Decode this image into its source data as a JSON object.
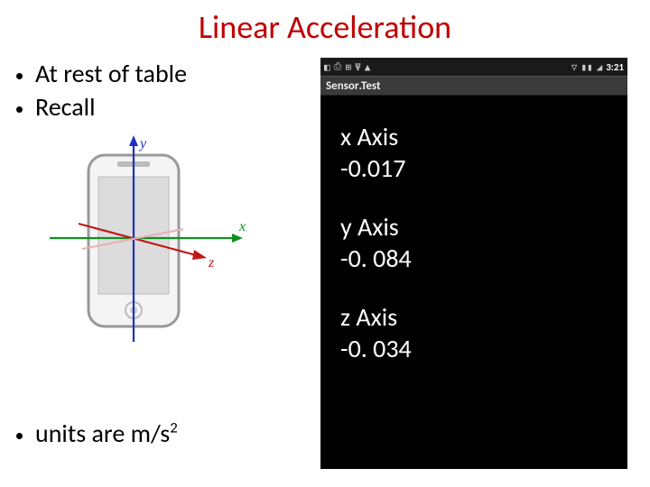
{
  "title": "Linear Acceleration",
  "bullets": {
    "b1": "At rest of table",
    "b2": "Recall",
    "b3_prefix": "units are m/s",
    "b3_exp": "2"
  },
  "axes": {
    "x": "x",
    "y": "y",
    "z": "z"
  },
  "statusbar": {
    "icons": [
      "◧",
      "⎙",
      "⊞",
      "Ψ",
      "▲"
    ],
    "right_icons": [
      "▽",
      "▮▮",
      "◢"
    ],
    "time": "3:21"
  },
  "appbar": {
    "title_a": "Sensor",
    "title_b": ".Test"
  },
  "readings": {
    "x_label": "x Axis",
    "x_value": "-0.017",
    "y_label": "y Axis",
    "y_value": "-0. 084",
    "z_label": "z Axis",
    "z_value": "-0. 034"
  }
}
